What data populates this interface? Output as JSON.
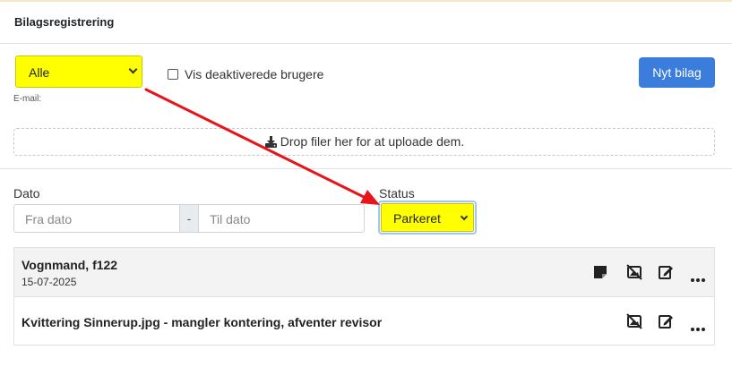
{
  "header": {
    "title": "Bilagsregistrering"
  },
  "filters": {
    "user_select": "Alle",
    "email_label": "E-mail:",
    "show_deactivated_label": "Vis deaktiverede brugere",
    "new_button": "Nyt bilag"
  },
  "dropzone": {
    "text": "Drop filer her for at uploade dem."
  },
  "search": {
    "date_label": "Dato",
    "from_placeholder": "Fra dato",
    "separator": "-",
    "to_placeholder": "Til dato",
    "status_label": "Status",
    "status_value": "Parkeret"
  },
  "items": [
    {
      "title": "Vognmand, f122",
      "date": "15-07-2025"
    },
    {
      "title": "Kvittering Sinnerup.jpg - mangler kontering, afventer revisor"
    }
  ],
  "icons": [
    "note-icon",
    "image-off-icon",
    "edit-icon",
    "more-icon"
  ],
  "colors": {
    "highlight": "#ffff00",
    "primary": "#3b7ddd",
    "arrow": "#e8141b"
  }
}
